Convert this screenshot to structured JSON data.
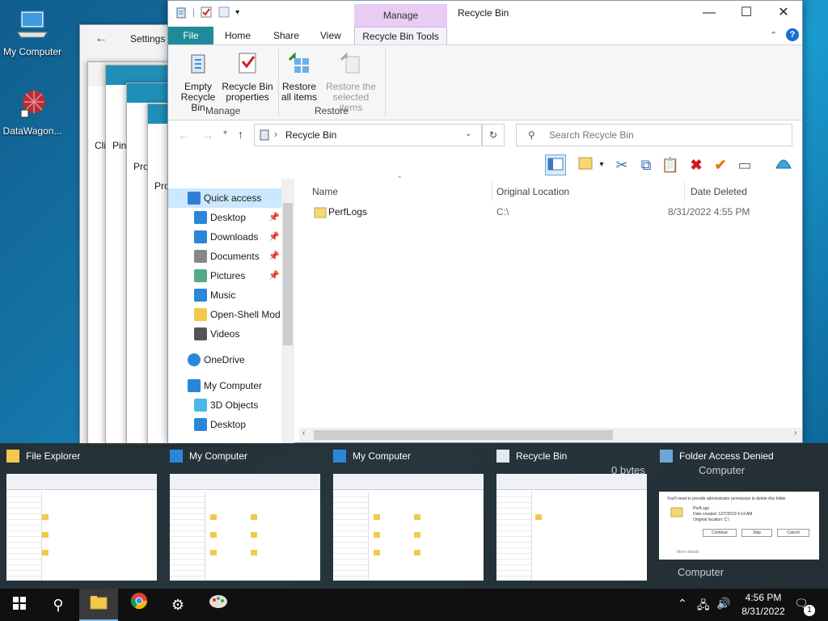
{
  "desktop": {
    "icons": [
      {
        "label": "My Computer",
        "icon": "monitor-icon"
      },
      {
        "label": "DataWagon...",
        "icon": "datawagon-icon"
      }
    ]
  },
  "background_windows": {
    "settings_title": "Settings",
    "fragments": [
      "Cli",
      "Pin",
      "Pro",
      "Pro"
    ]
  },
  "window": {
    "title": "Recycle Bin",
    "context_tab": "Manage",
    "qat": [
      "properties-icon",
      "checkmark-icon",
      "new-folder-icon",
      "qat-dropdown-icon"
    ],
    "controls": {
      "minimize": "—",
      "maximize": "☐",
      "close": "✕"
    },
    "tabs": [
      "File",
      "Home",
      "Share",
      "View",
      "Recycle Bin Tools"
    ],
    "ribbon": {
      "manage_group": "Manage",
      "restore_group": "Restore",
      "buttons": [
        {
          "line1": "Empty",
          "line2": "Recycle Bin",
          "enabled": true
        },
        {
          "line1": "Recycle Bin",
          "line2": "properties",
          "enabled": true
        },
        {
          "line1": "Restore",
          "line2": "all items",
          "enabled": true
        },
        {
          "line1": "Restore the",
          "line2": "selected items",
          "enabled": false
        }
      ]
    },
    "address": {
      "path": "Recycle Bin",
      "separator": "›"
    },
    "search": {
      "placeholder": "Search Recycle Bin"
    },
    "toolbar_icons": [
      "layout-icon",
      "folder-options-icon",
      "dropdown-icon",
      "cut-icon",
      "copy-icon",
      "paste-icon",
      "delete-icon",
      "check-icon",
      "rename-icon",
      "openshell-icon"
    ],
    "nav": [
      {
        "label": "Quick access",
        "icon": "star-icon",
        "level": 0,
        "selected": true,
        "pinned": false
      },
      {
        "label": "Desktop",
        "icon": "desktop-icon",
        "level": 1,
        "pinned": true
      },
      {
        "label": "Downloads",
        "icon": "download-icon",
        "level": 1,
        "pinned": true
      },
      {
        "label": "Documents",
        "icon": "documents-icon",
        "level": 1,
        "pinned": true
      },
      {
        "label": "Pictures",
        "icon": "pictures-icon",
        "level": 1,
        "pinned": true
      },
      {
        "label": "Music",
        "icon": "music-icon",
        "level": 1,
        "pinned": false
      },
      {
        "label": "Open-Shell Mod",
        "icon": "folder-icon",
        "level": 1,
        "pinned": false
      },
      {
        "label": "Videos",
        "icon": "videos-icon",
        "level": 1,
        "pinned": false
      },
      {
        "label": "OneDrive",
        "icon": "cloud-icon",
        "level": 0,
        "pinned": false
      },
      {
        "label": "My Computer",
        "icon": "monitor-icon",
        "level": 0,
        "pinned": false
      },
      {
        "label": "3D Objects",
        "icon": "cube-icon",
        "level": 1,
        "pinned": false
      },
      {
        "label": "Desktop",
        "icon": "desktop-icon",
        "level": 1,
        "pinned": false
      }
    ],
    "columns": [
      "Name",
      "Original Location",
      "Date Deleted"
    ],
    "rows": [
      {
        "name": "PerfLogs",
        "location": "C:\\",
        "date": "8/31/2022 4:55 PM"
      }
    ]
  },
  "switcher": {
    "items": [
      {
        "title": "File Explorer",
        "icon": "folder-icon"
      },
      {
        "title": "My Computer",
        "icon": "monitor-icon"
      },
      {
        "title": "My Computer",
        "icon": "monitor-icon"
      },
      {
        "title": "Recycle Bin",
        "icon": "recycle-bin-icon"
      },
      {
        "title": "Folder Access Denied",
        "icon": "dialog-icon"
      }
    ],
    "background_hints": [
      "0 bytes",
      "Computer",
      "Computer"
    ],
    "dialog": {
      "message": "You'll need to provide administrator permission to delete this folder",
      "name": "PerfLogs",
      "created": "Date created: 12/7/2019 4:14 AM",
      "location": "Original location: C:\\",
      "buttons": [
        "Continue",
        "Skip",
        "Cancel"
      ],
      "more": "More details"
    }
  },
  "taskbar": {
    "time": "4:56 PM",
    "date": "8/31/2022",
    "notification_count": "1",
    "apps": [
      "start-icon",
      "search-icon",
      "file-explorer-icon",
      "chrome-icon",
      "settings-icon",
      "paint-icon"
    ]
  },
  "colors": {
    "accent": "#1f8a9a",
    "context": "#e8ccf3",
    "selected": "#cce8ff"
  }
}
